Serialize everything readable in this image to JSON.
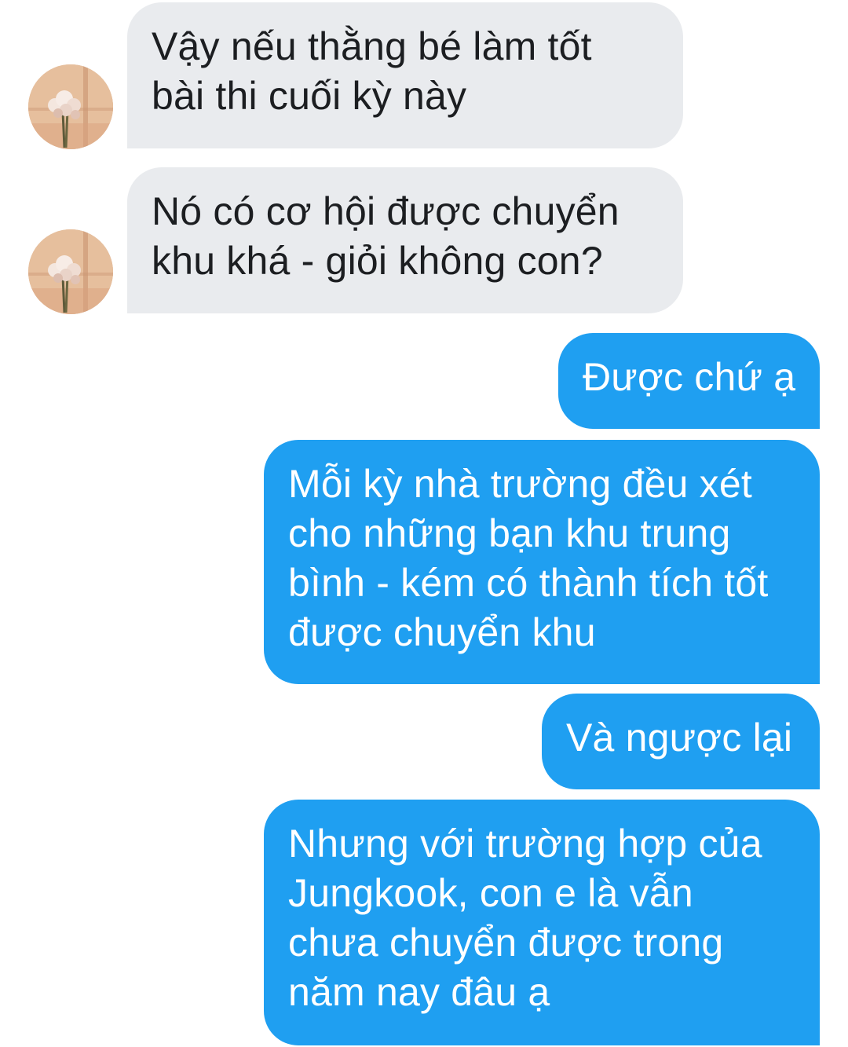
{
  "conversation": {
    "messages": [
      {
        "sender": "contact",
        "text": "Vậy nếu thằng bé làm tốt\nbài thi cuối kỳ này"
      },
      {
        "sender": "contact",
        "text": "Nó có cơ hội được chuyển\nkhu khá - giỏi không con?"
      },
      {
        "sender": "self",
        "text": "Được chứ ạ"
      },
      {
        "sender": "self",
        "text": "Mỗi kỳ nhà trường đều xét\ncho những bạn khu trung\nbình - kém có thành tích tốt\nđược chuyển khu"
      },
      {
        "sender": "self",
        "text": "Và ngược lại"
      },
      {
        "sender": "self",
        "text": "Nhưng với trường hợp của\nJungkook, con e là vẫn\nchưa chuyển được trong\nnăm nay đâu ạ"
      }
    ]
  },
  "colors": {
    "incoming_bubble": "#e9ebee",
    "outgoing_bubble": "#1f9ff1",
    "incoming_text": "#1c1e21",
    "outgoing_text": "#ffffff"
  }
}
